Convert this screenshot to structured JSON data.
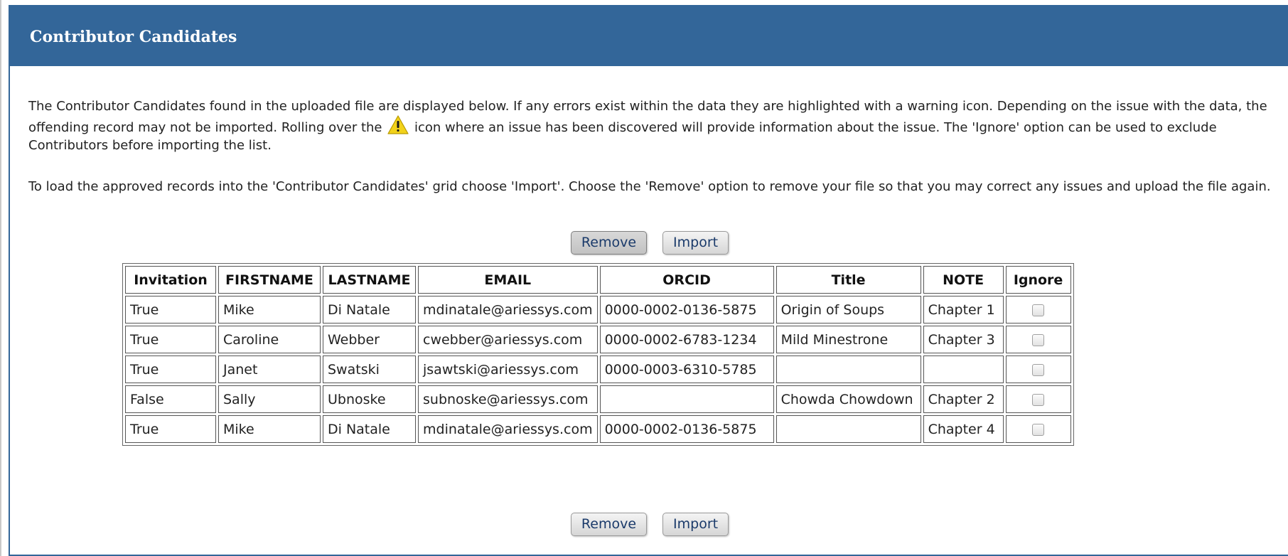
{
  "panel": {
    "title": "Contributor Candidates",
    "header_color": "#336699"
  },
  "intro": {
    "p1_before_icon": "The Contributor Candidates found in the uploaded file are displayed below. If any errors exist within the data they are highlighted with a warning icon. Depending on the issue with the data, the offending record may not be imported. Rolling over the ",
    "p1_icon": "warning-icon",
    "p1_after_icon": " icon where an issue has been discovered will provide information about the issue. The 'Ignore' option can be used to exclude Contributors before importing the list.",
    "p2": " To load the approved records into the 'Contributor Candidates' grid choose 'Import'. Choose the 'Remove' option to remove your file so that you may correct any issues and upload the file again."
  },
  "buttons": {
    "remove_label": "Remove",
    "import_label": "Import"
  },
  "table": {
    "columns": [
      "Invitation",
      "FIRSTNAME",
      "LASTNAME",
      "EMAIL",
      "ORCID",
      "Title",
      "NOTE",
      "Ignore"
    ],
    "rows": [
      [
        "True",
        "Mike",
        "Di Natale",
        "mdinatale@ariessys.com",
        "0000-0002-0136-5875",
        "Origin of Soups",
        "Chapter 1"
      ],
      [
        "True",
        "Caroline",
        "Webber",
        "cwebber@ariessys.com",
        "0000-0002-6783-1234",
        "Mild Minestrone",
        "Chapter 3"
      ],
      [
        "True",
        "Janet",
        "Swatski",
        "jsawtski@ariessys.com",
        "0000-0003-6310-5785",
        "",
        ""
      ],
      [
        "False",
        "Sally",
        "Ubnoske",
        "subnoske@ariessys.com",
        "",
        "Chowda Chowdown",
        "Chapter 2"
      ],
      [
        "True",
        "Mike",
        "Di Natale",
        "mdinatale@ariessys.com",
        "0000-0002-0136-5875",
        "",
        "Chapter 4"
      ]
    ],
    "ignore_checked": [
      false,
      false,
      false,
      false,
      false
    ]
  }
}
